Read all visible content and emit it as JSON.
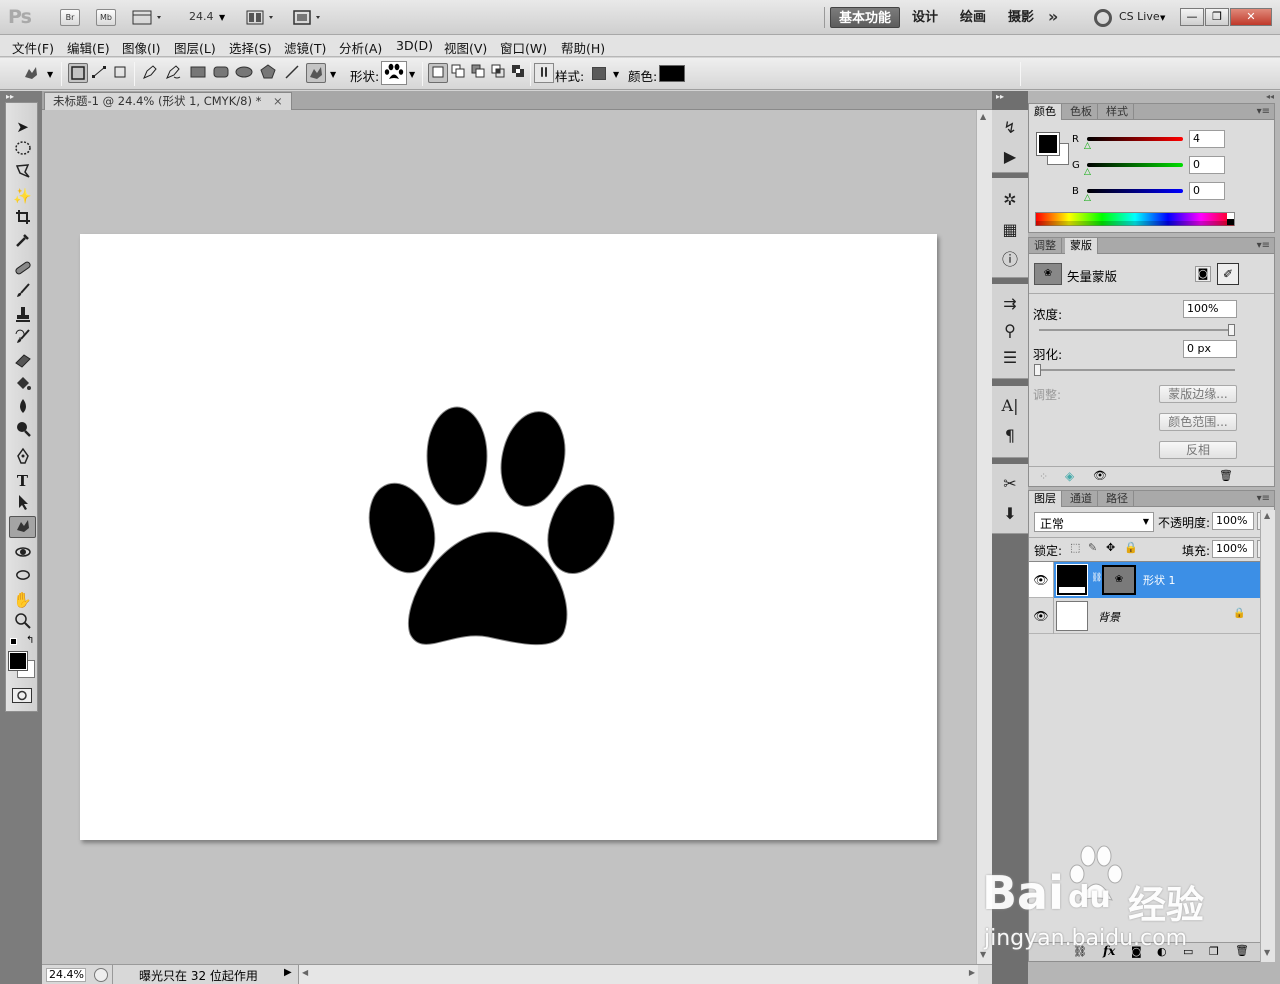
{
  "app": {
    "logo": "Ps",
    "bridge": "Br",
    "minibridge": "Mb",
    "zoom": "24.4"
  },
  "workspaces": [
    {
      "label": "基本功能",
      "active": true
    },
    {
      "label": "设计",
      "active": false
    },
    {
      "label": "绘画",
      "active": false
    },
    {
      "label": "摄影",
      "active": false
    }
  ],
  "workspace_more": "»",
  "cslive": "CS Live",
  "menu": [
    "文件(F)",
    "编辑(E)",
    "图像(I)",
    "图层(L)",
    "选择(S)",
    "滤镜(T)",
    "分析(A)",
    "3D(D)",
    "视图(V)",
    "窗口(W)",
    "帮助(H)"
  ],
  "options": {
    "shape_label": "形状:",
    "style_label": "样式:",
    "color_label": "颜色:"
  },
  "document": {
    "tab_title": "未标题-1 @ 24.4% (形状 1, CMYK/8) *",
    "close": "×"
  },
  "status": {
    "zoom": "24.4%",
    "info": "曝光只在 32 位起作用"
  },
  "color_panel": {
    "tabs": [
      "颜色",
      "色板",
      "样式"
    ],
    "channels": [
      {
        "label": "R",
        "value": "4",
        "color": "#d00000"
      },
      {
        "label": "G",
        "value": "0",
        "color": "#00b000"
      },
      {
        "label": "B",
        "value": "0",
        "color": "#0000d0"
      }
    ]
  },
  "mask_panel": {
    "tabs": [
      "调整",
      "蒙版"
    ],
    "title": "矢量蒙版",
    "density_label": "浓度:",
    "density_value": "100%",
    "feather_label": "羽化:",
    "feather_value": "0 px",
    "refine_label": "调整:",
    "buttons": [
      "蒙版边缘...",
      "颜色范围...",
      "反相"
    ]
  },
  "layers_panel": {
    "tabs": [
      "图层",
      "通道",
      "路径"
    ],
    "blend_mode": "正常",
    "opacity_label": "不透明度:",
    "opacity_value": "100%",
    "lock_label": "锁定:",
    "fill_label": "填充:",
    "fill_value": "100%",
    "layers": [
      {
        "name": "形状 1",
        "selected": true
      },
      {
        "name": "背景",
        "selected": false
      }
    ]
  },
  "watermark": {
    "brand_left": "Bai",
    "brand_right": "du",
    "brand_cn": "经验",
    "url": "jingyan.baidu.com"
  }
}
